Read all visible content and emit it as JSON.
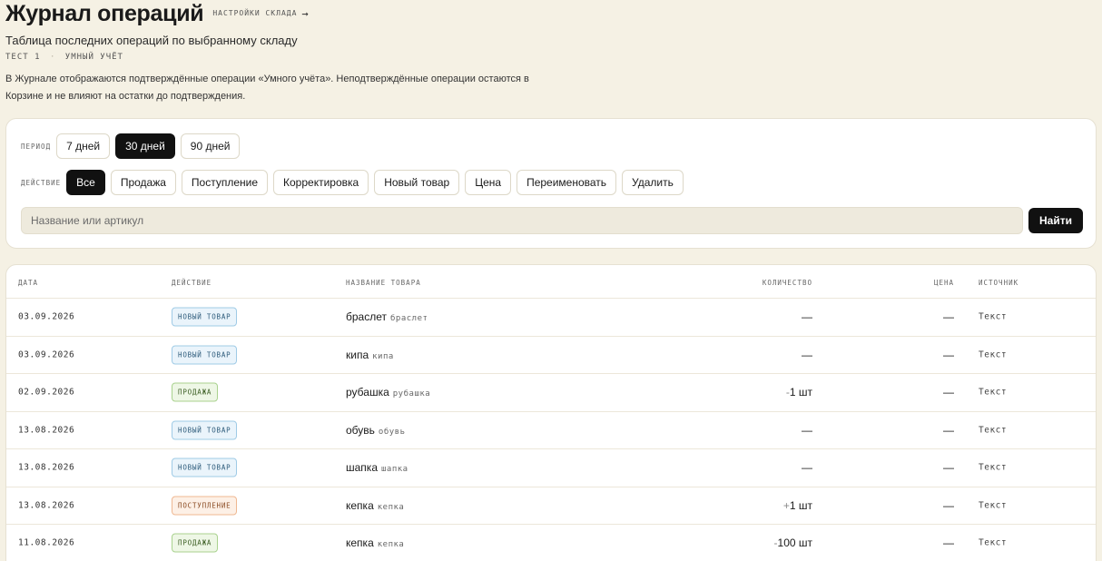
{
  "header": {
    "title": "Журнал операций",
    "settings_link": "НАСТРОЙКИ СКЛАДА",
    "settings_arrow": "→",
    "subtitle": "Таблица последних операций по выбранному складу",
    "meta_store": "ТЕСТ 1",
    "meta_dot": "·",
    "meta_app": "УМНЫЙ УЧЁТ",
    "description": "В Журнале отображаются подтверждённые операции «Умного учёта». Неподтверждённые операции остаются в Корзине и не влияют на остатки до подтверждения."
  },
  "filters": {
    "period_label": "ПЕРИОД",
    "period_options": [
      "7 дней",
      "30 дней",
      "90 дней"
    ],
    "period_selected": "30 дней",
    "action_label": "ДЕЙСТВИЕ",
    "action_options": [
      "Все",
      "Продажа",
      "Поступление",
      "Корректировка",
      "Новый товар",
      "Цена",
      "Переименовать",
      "Удалить"
    ],
    "action_selected": "Все",
    "search_placeholder": "Название или артикул",
    "search_value": "",
    "search_button": "Найти"
  },
  "table": {
    "columns": {
      "date": "ДАТА",
      "action": "ДЕЙСТВИЕ",
      "name": "НАЗВАНИЕ ТОВАРА",
      "qty": "КОЛИЧЕСТВО",
      "price": "ЦЕНА",
      "source": "ИСТОЧНИК"
    },
    "rows": [
      {
        "date": "03.09.2026",
        "action": "НОВЫЙ ТОВАР",
        "kind": "new",
        "name": "браслет",
        "sku": "браслет",
        "qty_sign": "",
        "qty": "—",
        "price": "—",
        "source": "Текст"
      },
      {
        "date": "03.09.2026",
        "action": "НОВЫЙ ТОВАР",
        "kind": "new",
        "name": "кипа",
        "sku": "кипа",
        "qty_sign": "",
        "qty": "—",
        "price": "—",
        "source": "Текст"
      },
      {
        "date": "02.09.2026",
        "action": "ПРОДАЖА",
        "kind": "sale",
        "name": "рубашка",
        "sku": "рубашка",
        "qty_sign": "-",
        "qty": "1 шт",
        "price": "—",
        "source": "Текст"
      },
      {
        "date": "13.08.2026",
        "action": "НОВЫЙ ТОВАР",
        "kind": "new",
        "name": "обувь",
        "sku": "обувь",
        "qty_sign": "",
        "qty": "—",
        "price": "—",
        "source": "Текст"
      },
      {
        "date": "13.08.2026",
        "action": "НОВЫЙ ТОВАР",
        "kind": "new",
        "name": "шапка",
        "sku": "шапка",
        "qty_sign": "",
        "qty": "—",
        "price": "—",
        "source": "Текст"
      },
      {
        "date": "13.08.2026",
        "action": "ПОСТУПЛЕНИЕ",
        "kind": "income",
        "name": "кепка",
        "sku": "кепка",
        "qty_sign": "+",
        "qty": "1 шт",
        "price": "—",
        "source": "Текст"
      },
      {
        "date": "11.08.2026",
        "action": "ПРОДАЖА",
        "kind": "sale",
        "name": "кепка",
        "sku": "кепка",
        "qty_sign": "-",
        "qty": "100 шт",
        "price": "—",
        "source": "Текст"
      }
    ]
  },
  "colors": {
    "background": "#f5f1e4",
    "accent_dark": "#111111",
    "badge_new": "#9fcbe6",
    "badge_sale": "#a9d28e",
    "badge_income": "#efb892"
  }
}
